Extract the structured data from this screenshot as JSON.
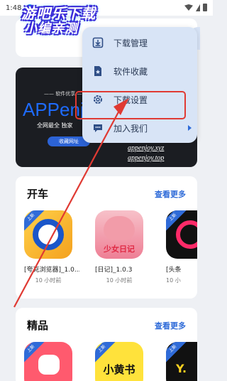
{
  "status_bar": {
    "time": "1:48"
  },
  "watermark": {
    "line1": "游吧乐下载",
    "line2": "小编亲测"
  },
  "banner": {
    "subtitle": "—— 软件优享 ——",
    "title": "APPenj",
    "tagline": "全网最全 独家",
    "button": "收藏网址",
    "url1": "appenjoy.xyz",
    "url2": "appenjoy.top"
  },
  "menu": {
    "items": [
      {
        "label": "下载管理",
        "icon": "download-box-icon"
      },
      {
        "label": "软件收藏",
        "icon": "star-doc-icon"
      },
      {
        "label": "下载设置",
        "icon": "gear-icon"
      },
      {
        "label": "加入我们",
        "icon": "chat-bubble-icon"
      }
    ]
  },
  "sections": [
    {
      "title": "开车",
      "more": "查看更多",
      "apps": [
        {
          "name": "[夸克浏览器]_1.0...",
          "time": "10 小时前",
          "badge": "上新"
        },
        {
          "name": "[日记]_1.0.3",
          "time": "10 小时前",
          "icon_text": "少女日记"
        },
        {
          "name": "[头条",
          "time": "10 小",
          "badge": "上新"
        }
      ]
    },
    {
      "title": "精品",
      "more": "查看更多",
      "apps": [
        {
          "badge": "上新"
        },
        {
          "badge": "上新",
          "icon_text": "小黄书"
        },
        {
          "badge": "上新",
          "icon_text": "Y."
        }
      ]
    }
  ],
  "colors": {
    "accent": "#2f6bd8",
    "highlight": "#e03a33",
    "menu_bg": "#d8e4f6"
  }
}
